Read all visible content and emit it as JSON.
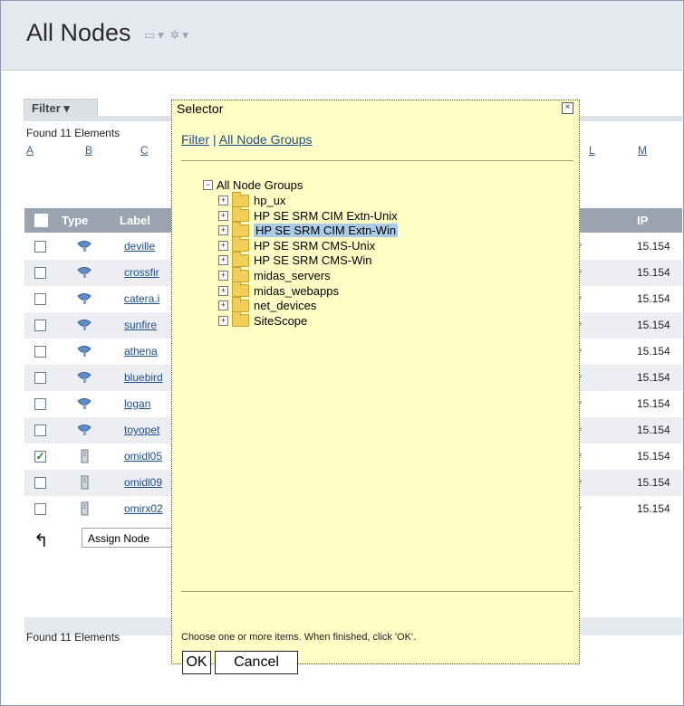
{
  "header": {
    "title": "All Nodes"
  },
  "filter": {
    "tab_label": "Filter ▾",
    "found_text": "Found 11 Elements"
  },
  "alpha_index": [
    "A",
    "B",
    "C",
    "L",
    "M"
  ],
  "table": {
    "columns": {
      "type": "Type",
      "label": "Label",
      "ip": "IP"
    },
    "rows": [
      {
        "label": "deville",
        "ip": "15.154",
        "kind": "satellite",
        "checked": false
      },
      {
        "label": "crossfir",
        "ip": "15.154",
        "kind": "satellite",
        "checked": false
      },
      {
        "label": "catera.i",
        "ip": "15.154",
        "kind": "satellite",
        "checked": false
      },
      {
        "label": "sunfire",
        "ip": "15.154",
        "kind": "satellite",
        "checked": false
      },
      {
        "label": "athena",
        "ip": "15.154",
        "kind": "satellite",
        "checked": false
      },
      {
        "label": "bluebird",
        "ip": "15.154",
        "kind": "satellite",
        "checked": false
      },
      {
        "label": "logan",
        "ip": "15.154",
        "kind": "satellite",
        "checked": false
      },
      {
        "label": "toyopet",
        "ip": "15.154",
        "kind": "satellite",
        "checked": false
      },
      {
        "label": "omidl05",
        "ip": "15.154",
        "kind": "server",
        "checked": true
      },
      {
        "label": "omidl09",
        "ip": "15.154",
        "kind": "server",
        "checked": false
      },
      {
        "label": "omirx02",
        "ip": "15.154",
        "kind": "server",
        "checked": false
      }
    ]
  },
  "assign": {
    "label": "Assign Node"
  },
  "footer": {
    "found_text": "Found 11 Elements"
  },
  "selector": {
    "title": "Selector",
    "close_glyph": "×",
    "link_filter": "Filter",
    "link_separator": " | ",
    "link_groups": "All Node Groups",
    "root": "All Node Groups",
    "groups": [
      "hp_ux",
      "HP SE SRM CIM Extn-Unix",
      "HP SE SRM CIM Extn-Win",
      "HP SE SRM CMS-Unix",
      "HP SE SRM CMS-Win",
      "midas_servers",
      "midas_webapps",
      "net_devices",
      "SiteScope"
    ],
    "selected_group": "HP SE SRM CIM Extn-Win",
    "hint": "Choose one or more items. When finished, click 'OK'.",
    "ok_label": "OK",
    "cancel_label": "Cancel"
  },
  "colors": {
    "dialog_bg": "#ffffc6",
    "header_bar": "#9aa4b0",
    "link": "#1f4f8c",
    "selected": "#a9cbe6"
  }
}
